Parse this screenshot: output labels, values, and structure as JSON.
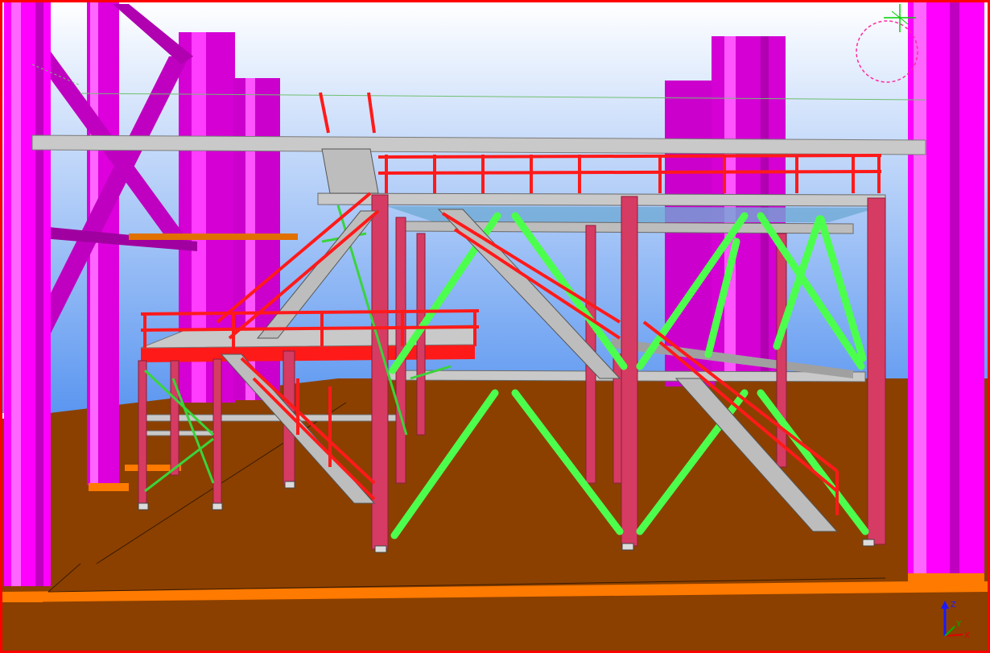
{
  "viewport": {
    "frame_color": "#ff0000",
    "sky_top": "#ffffff",
    "sky_bottom": "#5b96f0",
    "ground_color": "#8b4000"
  },
  "member_colors": {
    "main_column_magenta": "#ff00ff",
    "column_crimson": "#d63b63",
    "handrail_red": "#ff1a1a",
    "bracing_green": "#4dff4d",
    "beam_grey": "#c9c9c9",
    "base_plate_orange": "#ff7a00"
  },
  "icons": {
    "view_rotation_center": "rotation-center-icon",
    "coordinate_axes": "coordinate-axes-icon"
  },
  "axes": {
    "z_label": "Z",
    "x_label": "X",
    "y_label": "Y",
    "z_color": "#1a1aff",
    "x_color": "#e00000",
    "y_color": "#00b000"
  }
}
